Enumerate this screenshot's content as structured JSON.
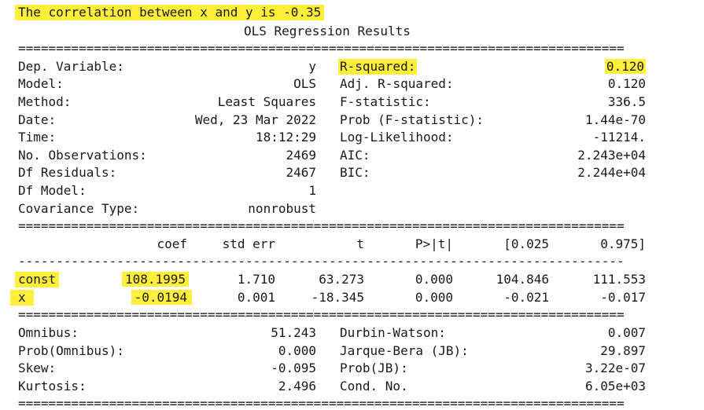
{
  "header": {
    "correlation_text": "The correlation between x and y is -0.35",
    "title": "OLS Regression Results"
  },
  "colors": {
    "highlight": "#ffef3a",
    "text": "#1a1a1a",
    "background": "#ffffff"
  },
  "summary": {
    "left": [
      {
        "label": "Dep. Variable:",
        "value": "y"
      },
      {
        "label": "Model:",
        "value": "OLS"
      },
      {
        "label": "Method:",
        "value": "Least Squares"
      },
      {
        "label": "Date:",
        "value": "Wed, 23 Mar 2022"
      },
      {
        "label": "Time:",
        "value": "18:12:29"
      },
      {
        "label": "No. Observations:",
        "value": "2469"
      },
      {
        "label": "Df Residuals:",
        "value": "2467"
      },
      {
        "label": "Df Model:",
        "value": "1"
      },
      {
        "label": "Covariance Type:",
        "value": "nonrobust"
      }
    ],
    "right": [
      {
        "label": "R-squared:",
        "value": "0.120"
      },
      {
        "label": "Adj. R-squared:",
        "value": "0.120"
      },
      {
        "label": "F-statistic:",
        "value": "336.5"
      },
      {
        "label": "Prob (F-statistic):",
        "value": "1.44e-70"
      },
      {
        "label": "Log-Likelihood:",
        "value": "-11214."
      },
      {
        "label": "AIC:",
        "value": "2.243e+04"
      },
      {
        "label": "BIC:",
        "value": "2.244e+04"
      }
    ]
  },
  "coef_table": {
    "headers": [
      "coef",
      "std err",
      "t",
      "P>|t|",
      "[0.025",
      "0.975]"
    ],
    "rows": [
      {
        "name": "const",
        "values": [
          "108.1995",
          "1.710",
          "63.273",
          "0.000",
          "104.846",
          "111.553"
        ]
      },
      {
        "name": "x",
        "values": [
          "-0.0194",
          "0.001",
          "-18.345",
          "0.000",
          "-0.021",
          "-0.017"
        ]
      }
    ]
  },
  "diagnostics": {
    "left": [
      {
        "label": "Omnibus:",
        "value": "51.243"
      },
      {
        "label": "Prob(Omnibus):",
        "value": "0.000"
      },
      {
        "label": "Skew:",
        "value": "-0.095"
      },
      {
        "label": "Kurtosis:",
        "value": "2.496"
      }
    ],
    "right": [
      {
        "label": "Durbin-Watson:",
        "value": "0.007"
      },
      {
        "label": "Jarque-Bera (JB):",
        "value": "29.897"
      },
      {
        "label": "Prob(JB):",
        "value": "3.22e-07"
      },
      {
        "label": "Cond. No.",
        "value": "6.05e+03"
      }
    ]
  },
  "separators": {
    "double": "================================================================================",
    "single": "--------------------------------------------------------------------------------"
  }
}
